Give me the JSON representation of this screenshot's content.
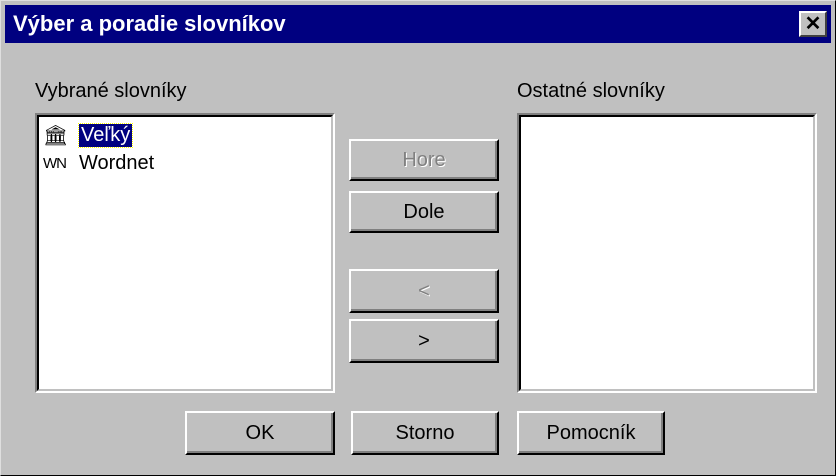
{
  "dialog": {
    "title": "Výber a poradie slovníkov",
    "close_glyph": "✕"
  },
  "left_panel": {
    "label": "Vybrané slovníky",
    "items": [
      {
        "icon": "bank-icon",
        "icon_text": "🏛",
        "label": "Veľký",
        "selected": true
      },
      {
        "icon": "wn-text-icon",
        "icon_text": "WN",
        "label": "Wordnet",
        "selected": false
      }
    ]
  },
  "right_panel": {
    "label": "Ostatné slovníky",
    "items": []
  },
  "buttons": {
    "up": "Hore",
    "down": "Dole",
    "move_left": "<",
    "move_right": ">",
    "ok": "OK",
    "cancel": "Storno",
    "help": "Pomocník"
  }
}
